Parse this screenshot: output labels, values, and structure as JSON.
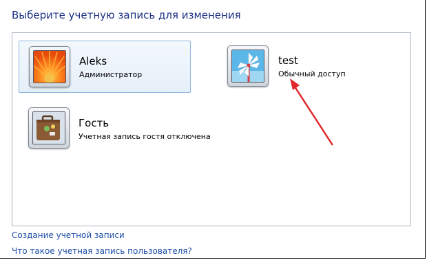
{
  "heading": "Выберите учетную запись для изменения",
  "accounts": [
    {
      "name": "Aleks",
      "role": "Администратор",
      "picture": "orange-flower-icon",
      "selected": true
    },
    {
      "name": "test",
      "role": "Обычный доступ",
      "picture": "pinwheel-icon",
      "selected": false
    },
    {
      "name": "Гость",
      "role": "Учетная запись гостя отключена",
      "picture": "suitcase-icon",
      "selected": false
    }
  ],
  "links": {
    "create_account": "Создание учетной записи",
    "what_is_account": "Что такое учетная запись пользователя?"
  },
  "colors": {
    "heading": "#1e3287",
    "link": "#1f50a8",
    "annotation_arrow": "#e0282d",
    "selection_border": "#8fb5e2"
  }
}
